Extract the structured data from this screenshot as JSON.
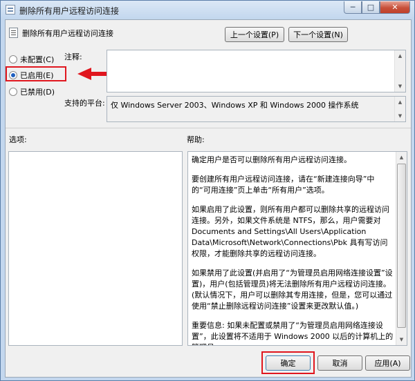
{
  "window": {
    "title": "删除所有用户远程访问连接",
    "minimize": "─",
    "maximize": "□",
    "close": "✕"
  },
  "header": {
    "setting_title": "删除所有用户远程访问连接",
    "prev_button": "上一个设置(P)",
    "next_button": "下一个设置(N)"
  },
  "state": {
    "options": [
      {
        "label": "未配置(C)",
        "checked": false
      },
      {
        "label": "已启用(E)",
        "checked": true
      },
      {
        "label": "已禁用(D)",
        "checked": false
      }
    ]
  },
  "comment": {
    "label": "注释:",
    "value": ""
  },
  "platform": {
    "label": "支持的平台:",
    "value": "仅 Windows Server 2003、Windows XP 和 Windows 2000 操作系统"
  },
  "options_label": "选项:",
  "help": {
    "label": "帮助:",
    "paragraphs": [
      "确定用户是否可以删除所有用户远程访问连接。",
      "要创建所有用户远程访问连接，请在“新建连接向导”中的“可用连接”页上单击“所有用户”选项。",
      "如果启用了此设置，则所有用户都可以删除共享的远程访问连接。另外，如果文件系统是 NTFS，那么，用户需要对 Documents and Settings\\All Users\\Application Data\\Microsoft\\Network\\Connections\\Pbk 具有写访问权限，才能删除共享的远程访问连接。",
      "如果禁用了此设置(并启用了“为管理员启用网络连接设置”设置)，用户(包括管理员)将无法删除所有用户远程访问连接。(默认情况下，用户可以删除其专用连接，但是，您可以通过使用“禁止删除远程访问连接”设置来更改默认值。)",
      "重要信息: 如果未配置或禁用了“为管理员启用网络连接设置”，此设置将不适用于 Windows 2000 以后的计算机上的管理员。"
    ]
  },
  "footer": {
    "ok": "确定",
    "cancel": "取消",
    "apply": "应用(A)"
  },
  "accent_colors": {
    "annotation_red": "#e0161e",
    "radio_selected": "#1f5fbf"
  }
}
